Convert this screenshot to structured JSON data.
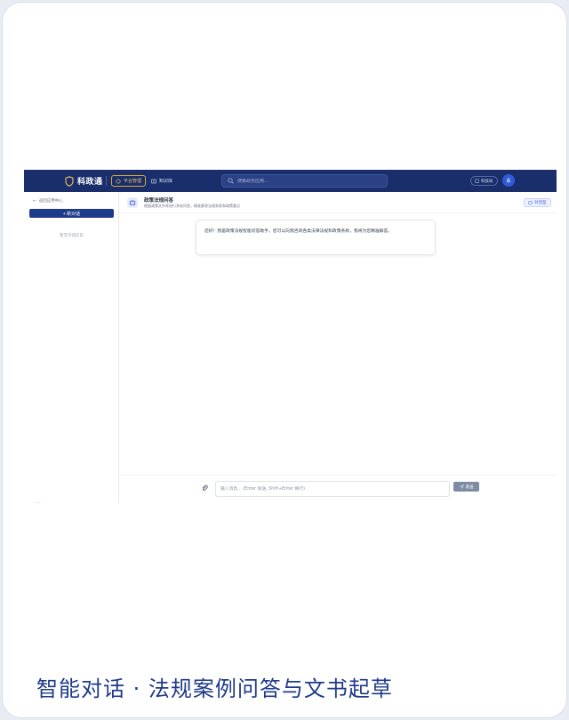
{
  "brand": {
    "name": "科政通",
    "color": "#f1c45a"
  },
  "nav": {
    "tabs": [
      {
        "label": "平台管理",
        "active": true
      },
      {
        "label": "知识库",
        "active": false
      }
    ]
  },
  "search": {
    "placeholder": "搜索政务应用..."
  },
  "header_right": {
    "kb_label": "科技局",
    "avatar": "系"
  },
  "sidebar": {
    "back_label": "返回应用中心",
    "new_chat_label": "+ 新对话",
    "empty_history": "暂无对话历史",
    "badge": "N"
  },
  "chat": {
    "title": "政策法规问答",
    "subtitle": "根据政策文件库进行多轮问答，精准解答法规条款和政策要点",
    "badge": "对话型",
    "greeting": "您好！我是政策法规智能问答助手。您可以向我咨询各类法律法规和政策条款，我将为您精准解答。"
  },
  "composer": {
    "placeholder": "输入消息... (Enter 发送, Shift+Enter 换行)",
    "send_label": "发送"
  },
  "caption": "智能对话 · 法规案例问答与文书起草",
  "colors": {
    "nav_bg": "#1a2e6b",
    "primary": "#1e3a8a",
    "caption": "#1e3a8a"
  }
}
